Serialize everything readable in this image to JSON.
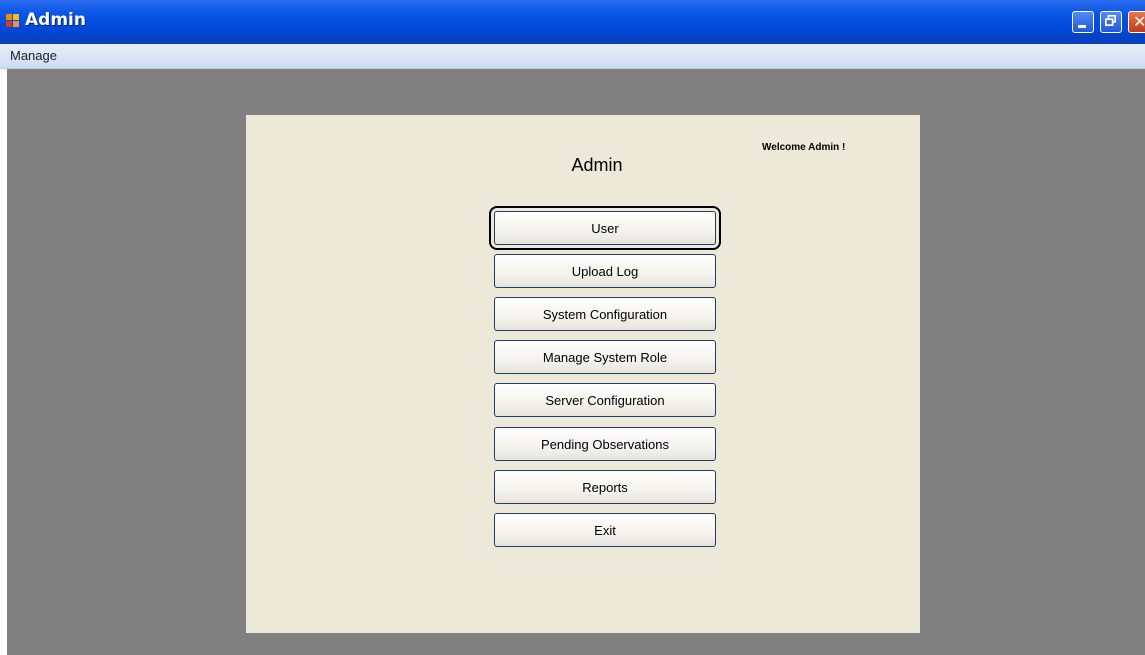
{
  "window": {
    "title": "Admin",
    "controls": {
      "minimize": "minimize",
      "restore": "restore",
      "close": "close"
    }
  },
  "menu": {
    "items": [
      "Manage"
    ]
  },
  "form": {
    "title": "Admin",
    "welcome": "Welcome Admin !",
    "buttons": [
      "User",
      "Upload Log",
      "System Configuration",
      "Manage System Role",
      "Server Configuration",
      "Pending Observations",
      "Reports",
      "Exit"
    ],
    "focused_button": "User"
  },
  "colors": {
    "titlebar": "#0b56e5",
    "mdi_background": "#808080",
    "form_background": "#ece9d8"
  }
}
